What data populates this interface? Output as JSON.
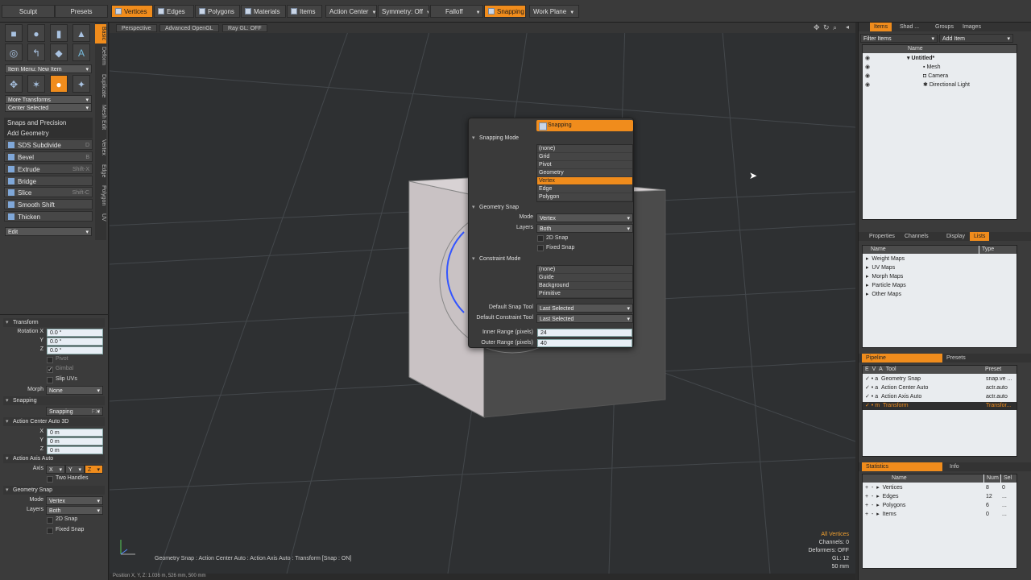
{
  "topbar": {
    "left_buttons": [
      "Sculpt",
      "Presets"
    ],
    "mode_buttons": [
      "Vertices",
      "Edges",
      "Polygons",
      "Materials",
      "Items"
    ],
    "action_center": "Action Center",
    "symmetry": "Symmetry: Off",
    "falloff": "Falloff",
    "snapping": "Snapping",
    "work_plane": "Work Plane"
  },
  "left": {
    "vtabs": [
      "Basic",
      "Deform",
      "Duplicate",
      "Mesh Edit",
      "Vertex",
      "Edge",
      "Polygon",
      "UV"
    ],
    "item_menu": "Item Menu: New Item",
    "more_transforms": "More Transforms",
    "center_selected": "Center Selected",
    "snaps_header": "Snaps and Precision",
    "add_geometry": "Add Geometry",
    "tools": [
      {
        "label": "SDS Subdivide",
        "key": "D"
      },
      {
        "label": "Bevel",
        "key": "B"
      },
      {
        "label": "Extrude",
        "key": "Shift-X"
      },
      {
        "label": "Bridge",
        "key": ""
      },
      {
        "label": "Slice",
        "key": "Shift-C"
      },
      {
        "label": "Smooth Shift",
        "key": ""
      },
      {
        "label": "Thicken",
        "key": ""
      }
    ],
    "edit": "Edit",
    "props": {
      "transform": "Transform",
      "rotation_x_label": "Rotation X",
      "y_label": "Y",
      "z_label": "Z",
      "rot_x": "0.0 °",
      "rot_y": "0.0 °",
      "rot_z": "0.0 °",
      "pivot": "Pivot",
      "gimbal": "Gimbal",
      "slip_uvs": "Slip UVs",
      "morph_label": "Morph",
      "morph_value": "None",
      "snapping_section": "Snapping",
      "snapping_button": "Snapping",
      "snapping_key": "F11",
      "action_center_section": "Action Center Auto 3D",
      "x_label": "X",
      "ac_x": "0 m",
      "ac_y": "0 m",
      "ac_z": "0 m",
      "action_axis_section": "Action Axis Auto",
      "axis_label": "Axis",
      "axis_x": "X",
      "axis_y": "Y",
      "axis_z": "Z",
      "two_handles": "Two Handles",
      "geometry_snap_section": "Geometry Snap",
      "mode_label": "Mode",
      "mode_value": "Vertex",
      "layers_label": "Layers",
      "layers_value": "Both",
      "snap_2d": "2D Snap",
      "fixed_snap": "Fixed Snap"
    }
  },
  "viewport": {
    "buttons": [
      "Perspective",
      "Advanced OpenGL",
      "Ray GL: OFF"
    ],
    "status_line": "Geometry Snap : Action Center Auto : Action Axis Auto : Transform  [Snap : ON]",
    "info": {
      "all_vertices": "All Vertices",
      "channels": "Channels: 0",
      "deformers": "Deformers: OFF",
      "gl": "GL: 12",
      "scale": "50 mm"
    },
    "position_readout": "Position X, Y, Z:   1.036 m, 526 mm, 500 mm"
  },
  "popup": {
    "title": "Snapping",
    "snapping_mode_label": "Snapping Mode",
    "snapping_modes": [
      "(none)",
      "Grid",
      "Pivot",
      "Geometry",
      "Vertex",
      "Edge",
      "Polygon"
    ],
    "snapping_mode_selected": 4,
    "geometry_snap_label": "Geometry Snap",
    "mode_label": "Mode",
    "mode_value": "Vertex",
    "layers_label": "Layers",
    "layers_value": "Both",
    "snap_2d": "2D Snap",
    "fixed_snap": "Fixed Snap",
    "constraint_mode_label": "Constraint Mode",
    "constraint_modes": [
      "(none)",
      "Guide",
      "Background",
      "Primitive"
    ],
    "default_snap_tool_label": "Default Snap Tool",
    "default_snap_tool_value": "Last Selected",
    "default_constraint_tool_label": "Default Constraint Tool",
    "default_constraint_tool_value": "Last Selected",
    "inner_range_label": "Inner Range (pixels)",
    "inner_range_value": "24",
    "outer_range_label": "Outer Range (pixels)",
    "outer_range_value": "40"
  },
  "right": {
    "top_tabs": [
      "Items",
      "Shad ...",
      "Groups",
      "Images"
    ],
    "filter_items": "Filter Items",
    "add_item": "Add Item",
    "name_col": "Name",
    "tree": [
      "Untitled*",
      "Mesh",
      "Camera",
      "Directional Light"
    ],
    "mid_tabs": [
      "Properties",
      "Channels",
      "Display",
      "Lists"
    ],
    "lists_cols": [
      "Name",
      "Type"
    ],
    "lists": [
      "Weight Maps",
      "UV Maps",
      "Morph Maps",
      "Particle Maps",
      "Other Maps"
    ],
    "pipeline_tabs": [
      "Pipeline",
      "Presets"
    ],
    "pipeline_cols": [
      "E",
      "V",
      "A",
      "Tool",
      "Preset"
    ],
    "pipeline": [
      {
        "a": "a",
        "tool": "Geometry Snap",
        "preset": "snap.ve ..."
      },
      {
        "a": "a",
        "tool": "Action Center Auto",
        "preset": "actr.auto"
      },
      {
        "a": "a",
        "tool": "Action Axis Auto",
        "preset": "actr.auto"
      },
      {
        "a": "m",
        "tool": "Transform",
        "preset": "Transfor..."
      }
    ],
    "stats_tabs": [
      "Statistics",
      "Info"
    ],
    "stats_cols": [
      "Name",
      "Num",
      "Sel"
    ],
    "stats": [
      {
        "name": "Vertices",
        "num": "8",
        "sel": "0"
      },
      {
        "name": "Edges",
        "num": "12",
        "sel": "..."
      },
      {
        "name": "Polygons",
        "num": "6",
        "sel": "..."
      },
      {
        "name": "Items",
        "num": "0",
        "sel": "..."
      }
    ]
  },
  "colors": {
    "accent": "#f08c1c",
    "panel": "#3b3b3b",
    "viewport": "#2e3032"
  }
}
